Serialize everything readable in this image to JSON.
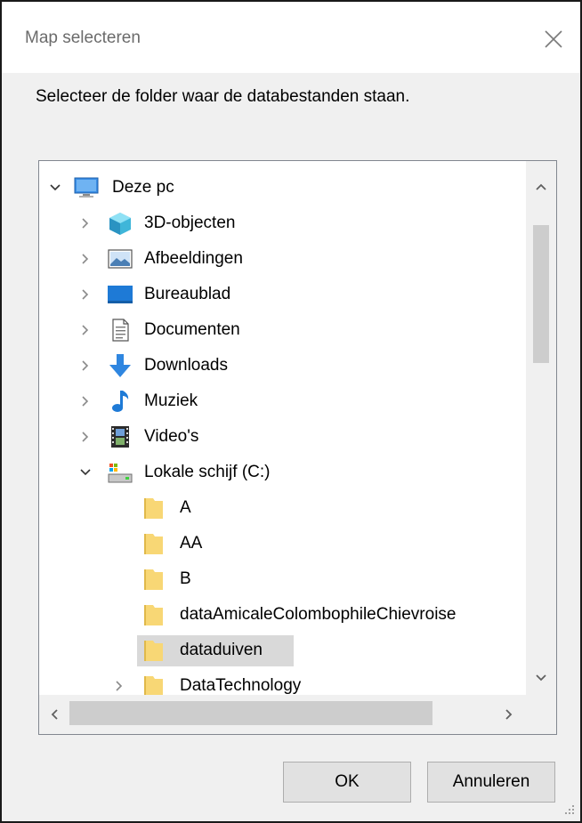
{
  "window": {
    "title": "Map selecteren",
    "instruction": "Selecteer de folder waar de databestanden staan."
  },
  "tree": {
    "items": [
      {
        "label": "Deze pc",
        "icon": "monitor-icon",
        "expanded": true
      },
      {
        "label": "3D-objecten",
        "icon": "3d-objects-icon",
        "expanded": false
      },
      {
        "label": "Afbeeldingen",
        "icon": "pictures-icon",
        "expanded": false
      },
      {
        "label": "Bureaublad",
        "icon": "desktop-icon",
        "expanded": false
      },
      {
        "label": "Documenten",
        "icon": "documents-icon",
        "expanded": false
      },
      {
        "label": "Downloads",
        "icon": "downloads-icon",
        "expanded": false
      },
      {
        "label": "Muziek",
        "icon": "music-icon",
        "expanded": false
      },
      {
        "label": "Video's",
        "icon": "videos-icon",
        "expanded": false
      },
      {
        "label": "Lokale schijf (C:)",
        "icon": "drive-icon",
        "expanded": true
      },
      {
        "label": "A",
        "icon": "folder-icon"
      },
      {
        "label": "AA",
        "icon": "folder-icon"
      },
      {
        "label": "B",
        "icon": "folder-icon"
      },
      {
        "label": "dataAmicaleColombophileChievroise",
        "icon": "folder-icon"
      },
      {
        "label": "dataduiven",
        "icon": "folder-icon",
        "selected": true
      },
      {
        "label": "DataTechnology",
        "icon": "folder-icon",
        "expanded": false
      }
    ]
  },
  "buttons": {
    "ok": "OK",
    "cancel": "Annuleren"
  },
  "colors": {
    "selection": "#d9d9d9",
    "folder": "#f8d775",
    "accent": "#1e7ad6"
  }
}
